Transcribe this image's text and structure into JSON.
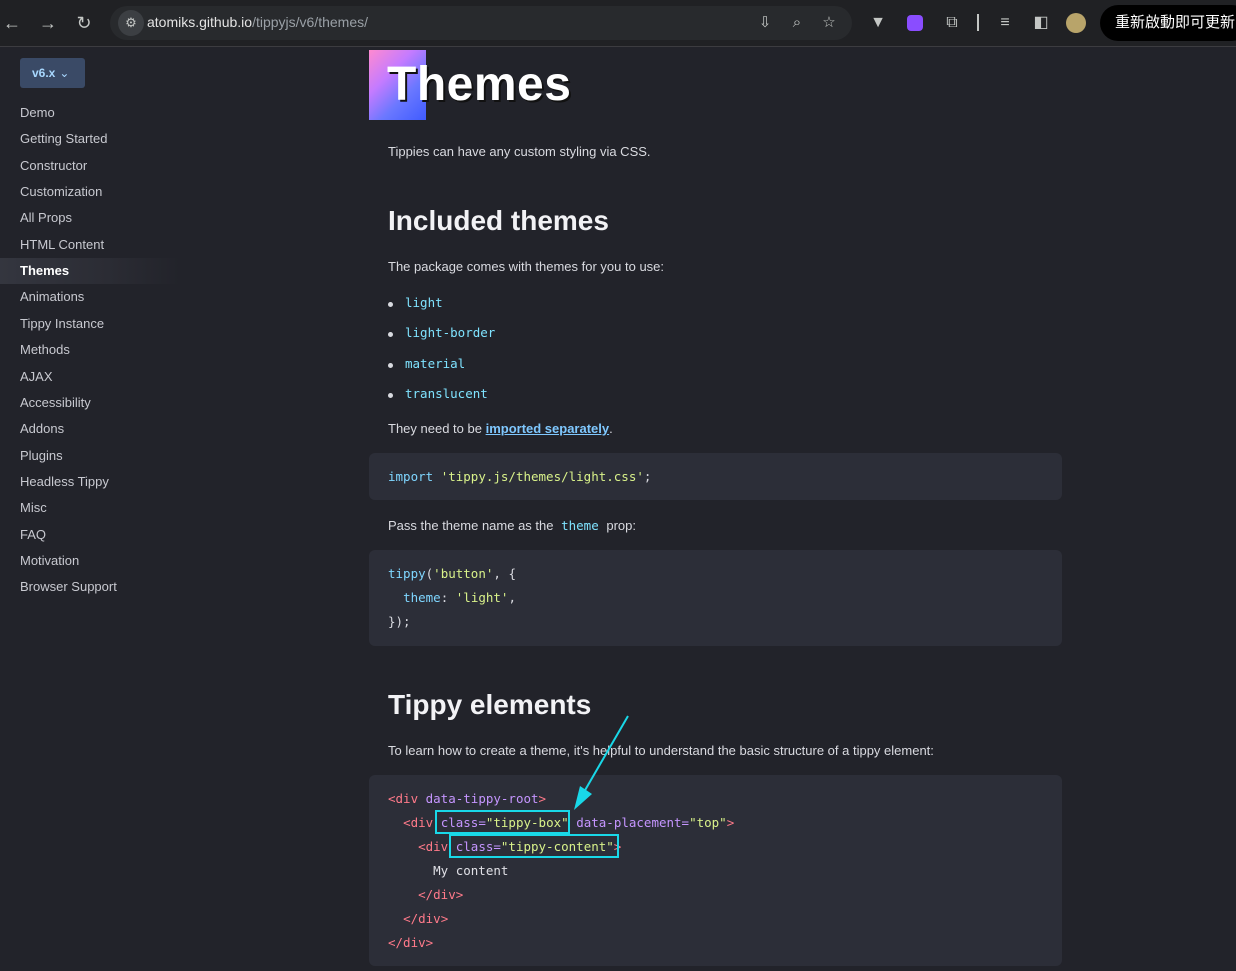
{
  "browser": {
    "url_domain": "atomiks.github.io",
    "url_path": "/tippyjs/v6/themes/",
    "update_button": "重新啟動即可更新"
  },
  "sidebar": {
    "version": "v6.x",
    "items": [
      {
        "label": "Demo"
      },
      {
        "label": "Getting Started"
      },
      {
        "label": "Constructor"
      },
      {
        "label": "Customization"
      },
      {
        "label": "All Props"
      },
      {
        "label": "HTML Content"
      },
      {
        "label": "Themes",
        "active": true
      },
      {
        "label": "Animations"
      },
      {
        "label": "Tippy Instance"
      },
      {
        "label": "Methods"
      },
      {
        "label": "AJAX"
      },
      {
        "label": "Accessibility"
      },
      {
        "label": "Addons"
      },
      {
        "label": "Plugins"
      },
      {
        "label": "Headless Tippy"
      },
      {
        "label": "Misc"
      },
      {
        "label": "FAQ"
      },
      {
        "label": "Motivation"
      },
      {
        "label": "Browser Support"
      }
    ]
  },
  "main": {
    "title": "Themes",
    "intro": "Tippies can have any custom styling via CSS.",
    "included_heading": "Included themes",
    "included_text": "The package comes with themes for you to use:",
    "themes": [
      "light",
      "light-border",
      "material",
      "translucent"
    ],
    "import_prefix": "They need to be ",
    "import_link": "imported separately",
    "import_suffix": ".",
    "import_code_keyword": "import",
    "import_code_string": "'tippy.js/themes/light.css'",
    "import_code_end": ";",
    "pass_prefix": "Pass the theme name as the",
    "pass_code": "theme",
    "pass_suffix": "prop:",
    "code2": {
      "fn": "tippy",
      "open": "(",
      "arg": "'button'",
      "rest": ", {",
      "prop": "theme",
      "colon": ": ",
      "value": "'light'",
      "comma": ",",
      "close": "});"
    },
    "elements_heading": "Tippy elements",
    "elements_text": "To learn how to create a theme, it's helpful to understand the basic structure of a tippy element:",
    "html_code": {
      "l1_tag": "<div",
      "l1_attr": " data-tippy-root",
      "l1_end": ">",
      "l2_tag": "<div",
      "l2_class_attr": "class=",
      "l2_class_val": "\"tippy-box\"",
      "l2_attr2": "data-placement=",
      "l2_val2": "\"top\"",
      "l2_end": ">",
      "l3_tag": "<div",
      "l3_class_attr": "class=",
      "l3_class_val": "\"tippy-content\"",
      "l3_end": ">",
      "l4_text": "My content",
      "l5": "</div>",
      "l6": "</div>",
      "l7": "</div>"
    }
  },
  "colors": {
    "accent": "#19d8e8",
    "background": "#22232a",
    "code_bg": "#2c2e38"
  }
}
